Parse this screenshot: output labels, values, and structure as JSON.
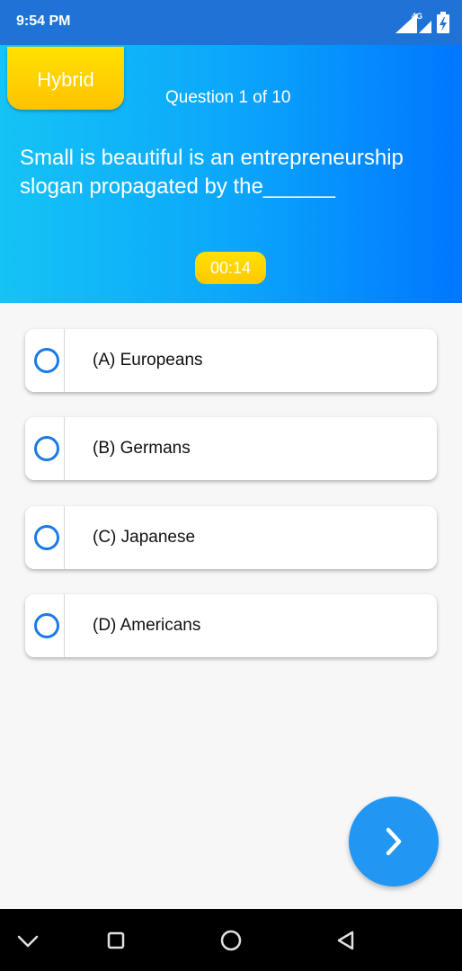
{
  "status_bar": {
    "time": "9:54 PM",
    "network": "4G",
    "icons": [
      "signal-icon",
      "battery-charging-icon"
    ]
  },
  "header": {
    "category": "Hybrid",
    "counter": "Question 1 of 10",
    "question": "Small is beautiful is an entrepreneurship slogan propagated by the______",
    "timer": "00:14"
  },
  "options": [
    {
      "label": "(A)  Europeans"
    },
    {
      "label": "(B)  Germans"
    },
    {
      "label": "(C)  Japanese"
    },
    {
      "label": "(D)  Americans"
    }
  ],
  "next_button": {
    "icon": "chevron-right-icon"
  },
  "nav_bar": {
    "icons": [
      "collapse-chevron-icon",
      "recents-square-icon",
      "home-circle-icon",
      "back-triangle-icon"
    ]
  },
  "colors": {
    "status_bar": "#1f73d6",
    "header_start": "#15c3f5",
    "header_end": "#0077ff",
    "accent_yellow": "#ffd000",
    "radio_blue": "#1a7ae8",
    "fab_blue": "#2196f3"
  }
}
